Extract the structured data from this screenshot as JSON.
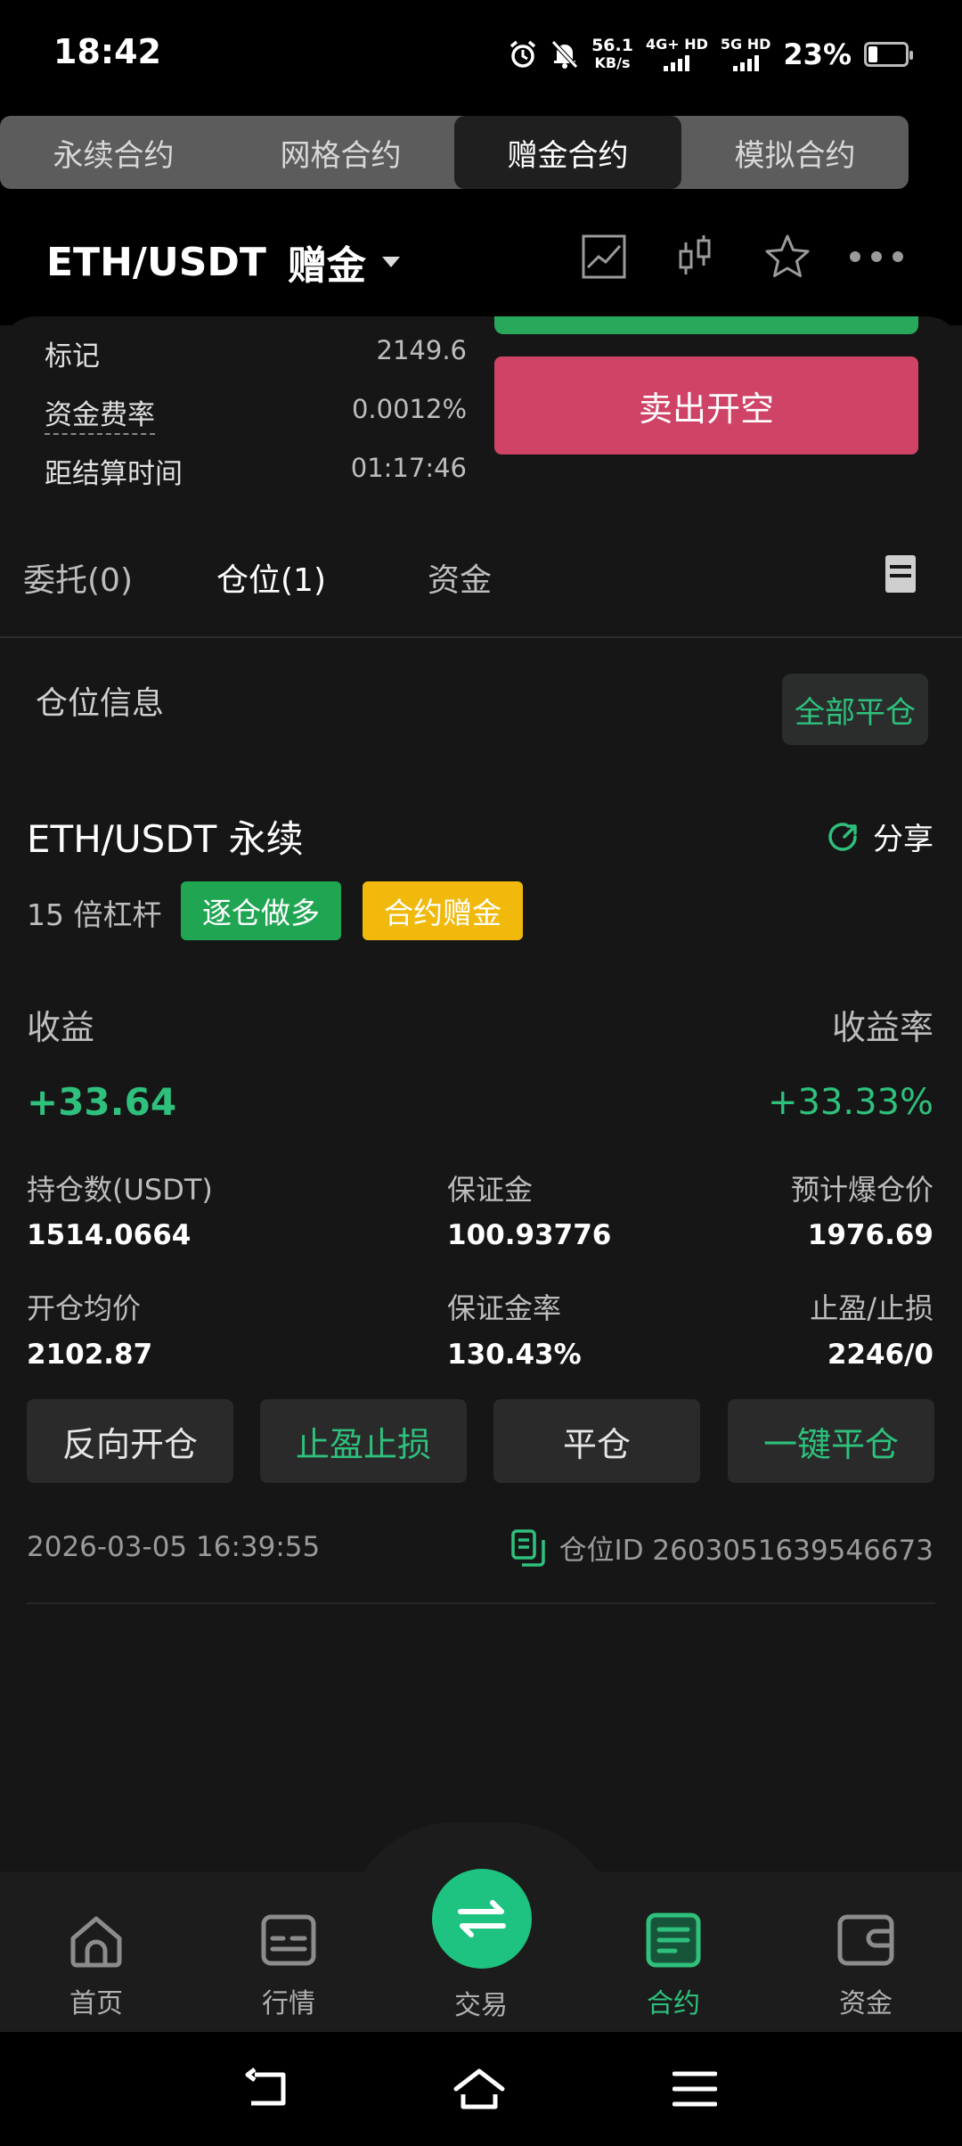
{
  "status_bar": {
    "time": "18:42",
    "net_speed": "56.1",
    "net_speed_unit": "KB/s",
    "sim1": "4G+ HD",
    "sim2": "5G HD",
    "battery": "23%",
    "battery_level": 0.23
  },
  "contract_tabs": [
    "永续合约",
    "网格合约",
    "赠金合约",
    "模拟合约"
  ],
  "active_contract_tab": 2,
  "header": {
    "pair": "ETH/USDT",
    "mode": "赠金"
  },
  "market_info": [
    {
      "label": "标记",
      "value": "2149.6"
    },
    {
      "label": "资金费率",
      "value": "0.0012%"
    },
    {
      "label": "距结算时间",
      "value": "01:17:46"
    }
  ],
  "sell_button": "卖出开空",
  "order_tabs": [
    "委托(0)",
    "仓位(1)",
    "资金"
  ],
  "position_section": {
    "title": "仓位信息",
    "close_all": "全部平仓"
  },
  "position": {
    "pair": "ETH/USDT 永续",
    "share": "分享",
    "leverage": "15 倍杠杆",
    "tag_side": "逐仓做多",
    "tag_bonus": "合约赠金",
    "pnl_label": "收益",
    "pnl_rate_label": "收益率",
    "pnl": "+33.64",
    "pnl_rate": "+33.33%",
    "stats": [
      {
        "label": "持仓数(USDT)",
        "value": "1514.0664"
      },
      {
        "label": "保证金",
        "value": "100.93776"
      },
      {
        "label": "预计爆仓价",
        "value": "1976.69"
      },
      {
        "label": "开仓均价",
        "value": "2102.87"
      },
      {
        "label": "保证金率",
        "value": "130.43%"
      },
      {
        "label": "止盈/止损",
        "value": "2246/0"
      }
    ],
    "actions": [
      "反向开仓",
      "止盈止损",
      "平仓",
      "一键平仓"
    ],
    "timestamp": "2026-03-05 16:39:55",
    "position_id": "仓位ID 2603051639546673"
  },
  "bottom_nav": [
    {
      "label": "首页",
      "icon": "home-icon"
    },
    {
      "label": "行情",
      "icon": "market-icon"
    },
    {
      "label": "交易",
      "icon": "swap-icon"
    },
    {
      "label": "合约",
      "icon": "contract-icon"
    },
    {
      "label": "资金",
      "icon": "wallet-icon"
    }
  ],
  "colors": {
    "accent_green": "#2ec07c",
    "sell_red": "#cf4366",
    "bonus_yellow": "#f0b90b"
  }
}
